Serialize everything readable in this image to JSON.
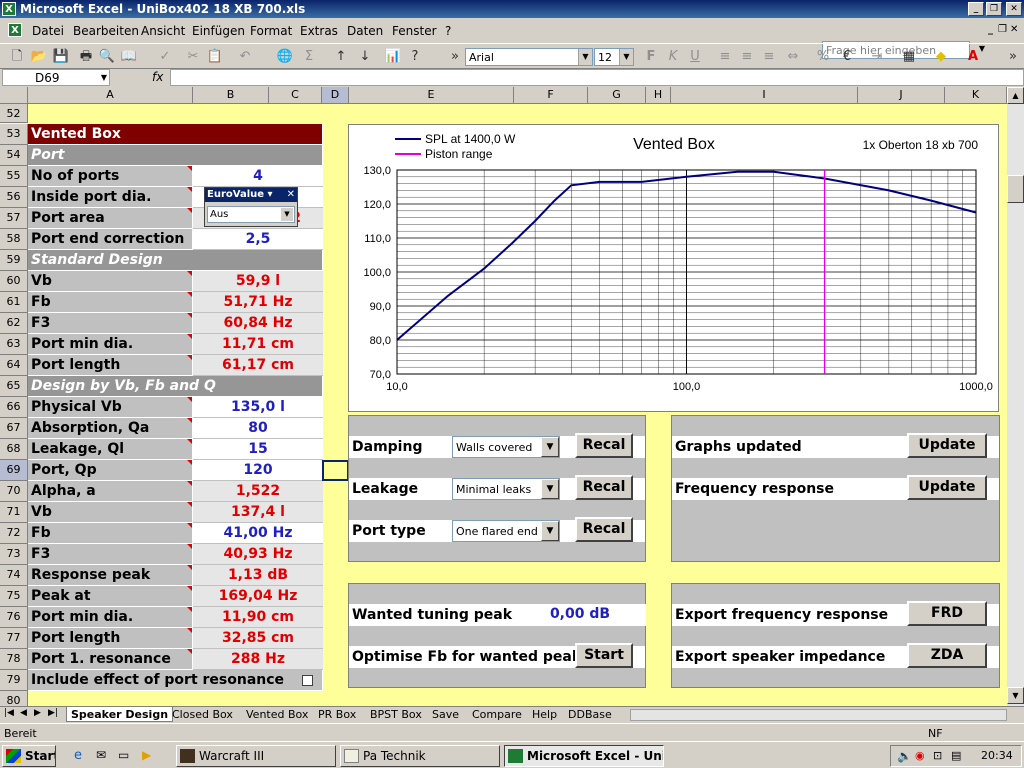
{
  "window": {
    "title": "Microsoft Excel - UniBox402 18 XB 700.xls",
    "app_icon": "excel-icon"
  },
  "menu": {
    "items": [
      "Datei",
      "Bearbeiten",
      "Ansicht",
      "Einfügen",
      "Format",
      "Extras",
      "Daten",
      "Fenster",
      "?"
    ],
    "help_placeholder": "Frage hier eingeben"
  },
  "toolbar": {
    "font": "Arial",
    "size": "12"
  },
  "formula": {
    "namebox": "D69",
    "fx": "fx",
    "content": ""
  },
  "columns": [
    "A",
    "B",
    "C",
    "D",
    "E",
    "F",
    "G",
    "H",
    "I",
    "J",
    "K"
  ],
  "rows": {
    "r52": "52",
    "r53": "53",
    "r54": "54",
    "r55": "55",
    "r56": "56",
    "r57": "57",
    "r58": "58",
    "r59": "59",
    "r60": "60",
    "r61": "61",
    "r62": "62",
    "r63": "63",
    "r64": "64",
    "r65": "65",
    "r66": "66",
    "r67": "67",
    "r68": "68",
    "r69": "69",
    "r70": "70",
    "r71": "71",
    "r72": "72",
    "r73": "73",
    "r74": "74",
    "r75": "75",
    "r76": "76",
    "r77": "77",
    "r78": "78",
    "r79": "79",
    "r80": "80"
  },
  "sheet": {
    "header": "Vented Box",
    "port_header": "Port",
    "no_ports_label": "No of ports",
    "no_ports": "4",
    "inside_port_label": "Inside port dia.",
    "port_area_label": "Port area",
    "port_area_fragment": "2",
    "port_end_label": "Port end correction",
    "port_end": "2,5",
    "std_header": "Standard Design",
    "vb_label": "Vb",
    "vb": "59,9  l",
    "fb_label": "Fb",
    "fb": "51,71  Hz",
    "f3_label": "F3",
    "f3": "60,84  Hz",
    "port_min_label": "Port min dia.",
    "port_min": "11,71  cm",
    "port_len_label": "Port length",
    "port_len": "61,17  cm",
    "design_header": "Design by Vb, Fb and Q",
    "phys_vb_label": "Physical Vb",
    "phys_vb": "135,0  l",
    "absorp_label": "Absorption, Qa",
    "absorp": "80",
    "leak_label": "Leakage, Ql",
    "leak": "15",
    "port_qp_label": "Port, Qp",
    "port_qp": "120",
    "alpha_label": "Alpha, a",
    "alpha": "1,522",
    "vb2_label": "Vb",
    "vb2": "137,4  l",
    "fb2_label": "Fb",
    "fb2": "41,00  Hz",
    "f32_label": "F3",
    "f32": "40,93  Hz",
    "resp_peak_label": "Response peak",
    "resp_peak": "1,13  dB",
    "peak_at_label": "Peak at",
    "peak_at": "169,04  Hz",
    "port_min2_label": "Port min dia.",
    "port_min2": "11,90  cm",
    "port_len2_label": "Port length",
    "port_len2": "32,85  cm",
    "port_res_label": "Port 1. resonance",
    "port_res": "288  Hz",
    "include_label": "Include effect of port resonance"
  },
  "eurovalue": {
    "title": "EuroValue",
    "value": "Aus"
  },
  "controls": {
    "damping_label": "Damping",
    "damping_value": "Walls covered",
    "leakage_label": "Leakage",
    "leakage_value": "Minimal leaks",
    "porttype_label": "Port type",
    "porttype_value": "One flared end",
    "recal": "Recal",
    "graphs_label": "Graphs updated",
    "freq_label": "Frequency response",
    "update": "Update",
    "tuning_label": "Wanted tuning peak",
    "tuning_value": "0,00  dB",
    "optimise_label": "Optimise Fb for wanted peak",
    "start": "Start",
    "export_freq_label": "Export frequency response",
    "frd": "FRD",
    "export_imp_label": "Export speaker impedance",
    "zda": "ZDA"
  },
  "chart_data": {
    "type": "line",
    "title": "Vented Box",
    "subtitle": "1x Oberton 18 xb 700",
    "x_scale": "log",
    "xlim": [
      10,
      1000
    ],
    "ylim": [
      70,
      130
    ],
    "x_ticks": [
      "10,0",
      "100,0",
      "1000,0"
    ],
    "y_ticks": [
      "70,0",
      "80,0",
      "90,0",
      "100,0",
      "110,0",
      "120,0",
      "130,0"
    ],
    "grid": true,
    "legend_position": "top-left",
    "series": [
      {
        "name": "SPL at 1400,0 W",
        "color": "#000080",
        "x": [
          10,
          15,
          20,
          25,
          30,
          35,
          40,
          50,
          70,
          100,
          150,
          200,
          300,
          500,
          700,
          1000
        ],
        "y": [
          80,
          93,
          101,
          108.5,
          115,
          121,
          125.5,
          126.5,
          126.5,
          128,
          129.5,
          129.5,
          127.5,
          124,
          121,
          117.5
        ]
      },
      {
        "name": "Piston range",
        "color": "#e000e0",
        "x": [
          300,
          300
        ],
        "y": [
          70,
          130
        ]
      }
    ]
  },
  "tabs": [
    "Speaker Design",
    "Closed Box",
    "Vented Box",
    "PR Box",
    "BPST Box",
    "Save",
    "Compare",
    "Help",
    "DDBase"
  ],
  "status": {
    "left": "Bereit",
    "right": "NF"
  },
  "taskbar": {
    "start": "Start",
    "tasks": [
      "Warcraft III",
      "Pa Technik",
      "Microsoft Excel - UniB..."
    ],
    "clock": "20:34"
  }
}
